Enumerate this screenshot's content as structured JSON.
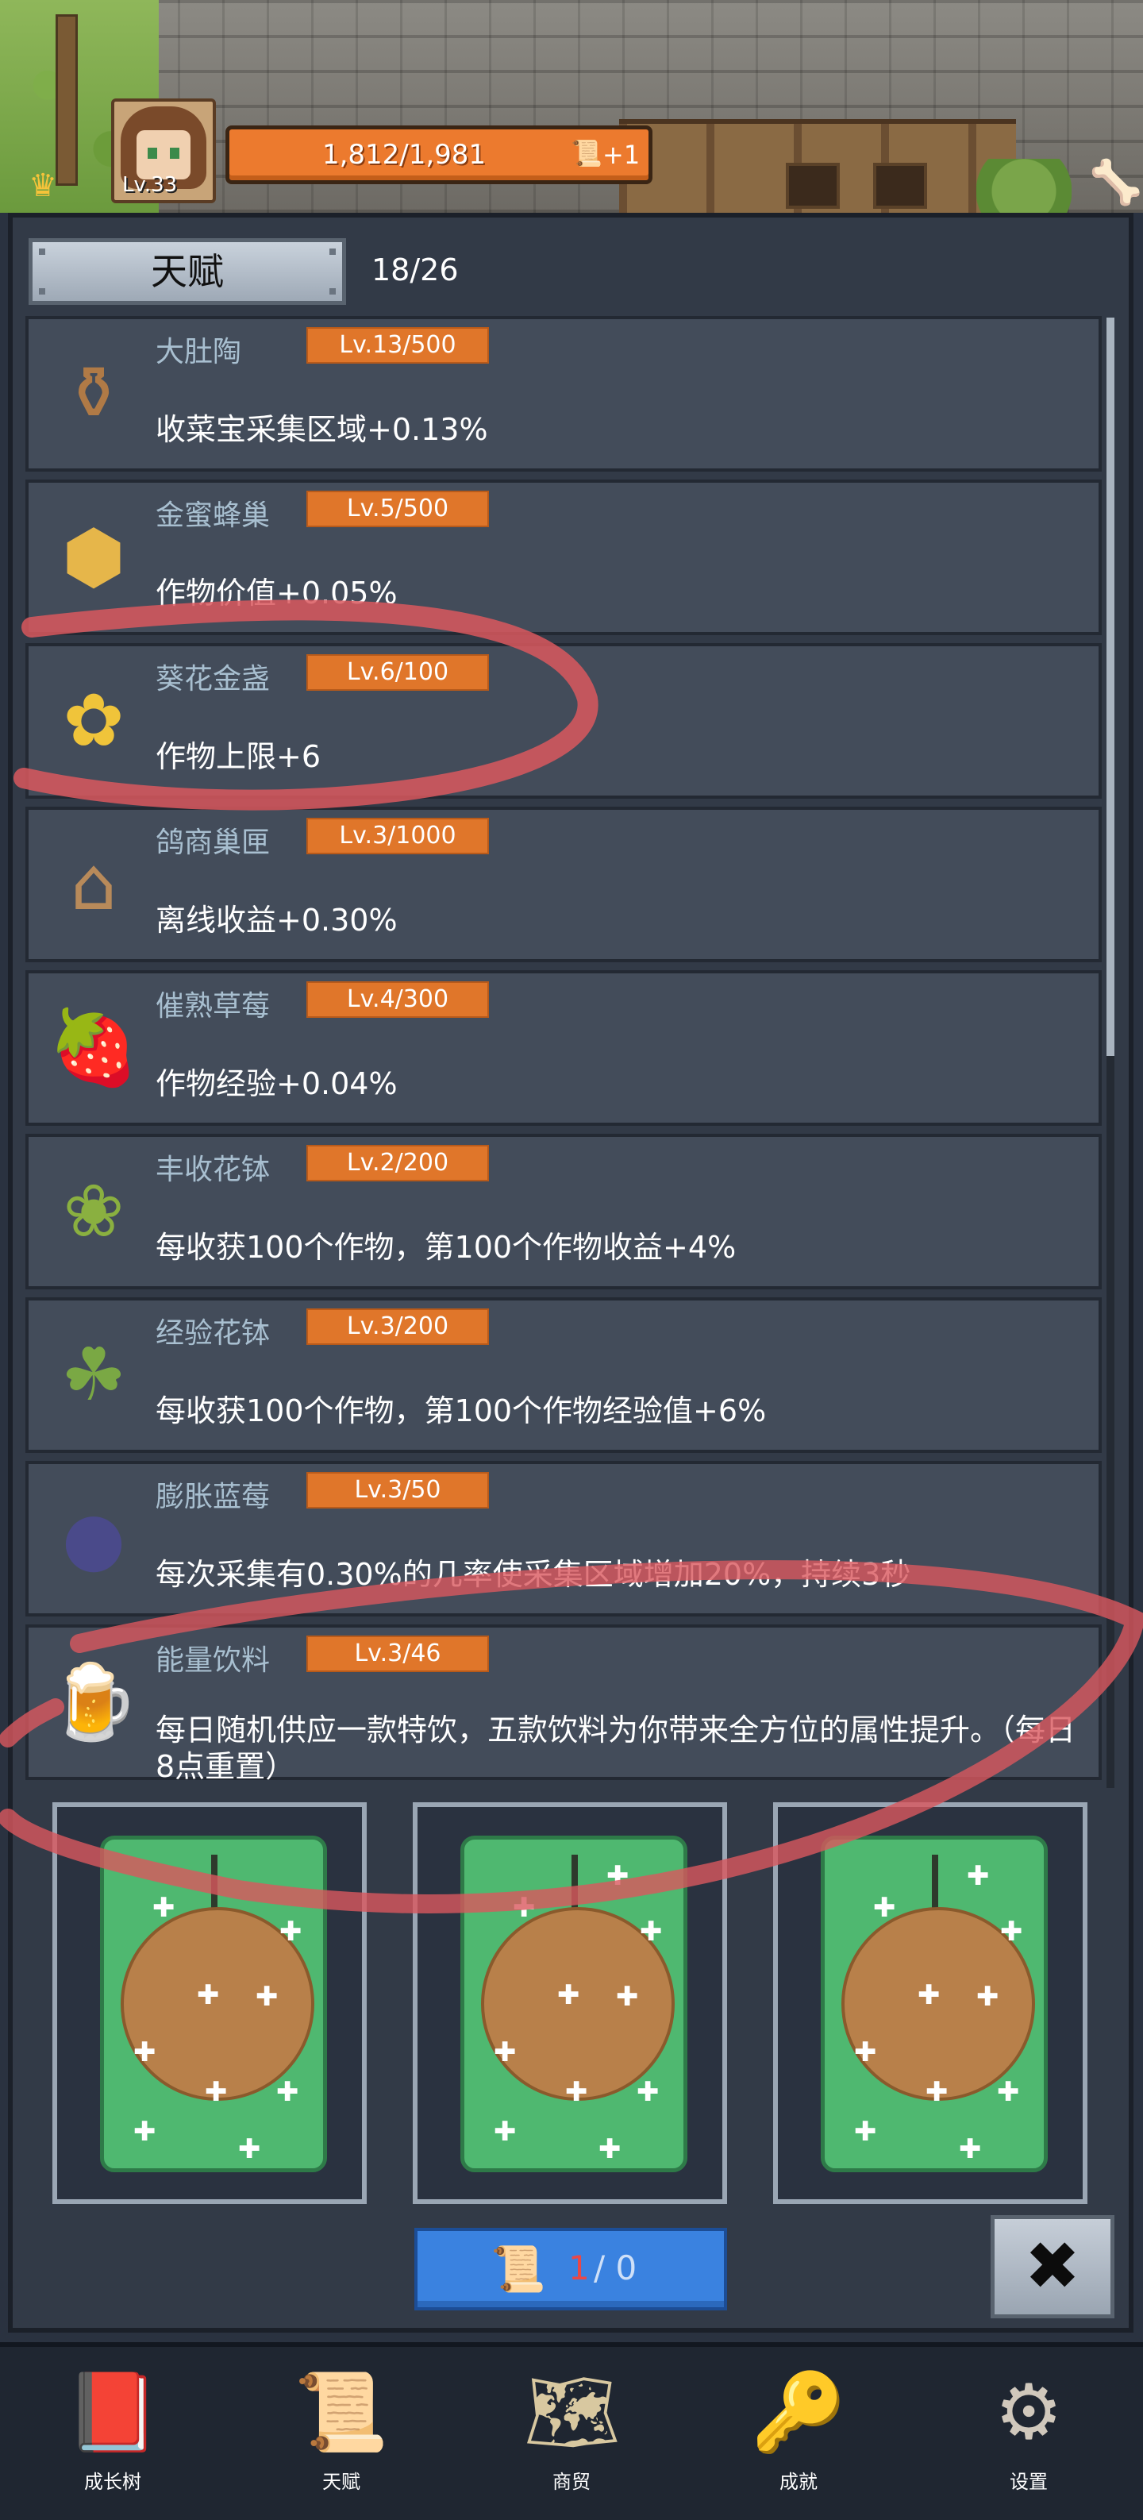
{
  "header": {
    "player_level": "Lv.33",
    "progress_text": "1,812/1,981",
    "bonus_text": "+1"
  },
  "panel": {
    "tab_label": "天赋",
    "count_text": "18/26"
  },
  "talents": [
    {
      "name": "大肚陶",
      "level": "Lv.13/500",
      "desc": "收菜宝采集区域+0.13%",
      "icon": "jar-icon"
    },
    {
      "name": "金蜜蜂巢",
      "level": "Lv.5/500",
      "desc": "作物价值+0.05%",
      "icon": "honeycomb-icon"
    },
    {
      "name": "葵花金盏",
      "level": "Lv.6/100",
      "desc": "作物上限+6",
      "icon": "sunflower-icon"
    },
    {
      "name": "鸽商巢匣",
      "level": "Lv.3/1000",
      "desc": "离线收益+0.30%",
      "icon": "birdhouse-icon"
    },
    {
      "name": "催熟草莓",
      "level": "Lv.4/300",
      "desc": "作物经验+0.04%",
      "icon": "strawberry-icon"
    },
    {
      "name": "丰收花钵",
      "level": "Lv.2/200",
      "desc": "每收获100个作物，第100个作物收益+4%",
      "icon": "flowerpot-icon"
    },
    {
      "name": "经验花钵",
      "level": "Lv.3/200",
      "desc": "每收获100个作物，第100个作物经验值+6%",
      "icon": "sprout-pot-icon"
    },
    {
      "name": "膨胀蓝莓",
      "level": "Lv.3/50",
      "desc": "每次采集有0.30%的几率使采集区域增加20%，持续3秒",
      "icon": "blueberry-icon"
    },
    {
      "name": "能量饮料",
      "level": "Lv.3/46",
      "desc": "每日随机供应一款特饮，五款饮料为你带来全方位的属性提升。（每日8点重置）",
      "icon": "drink-icon"
    }
  ],
  "scroll_counter": {
    "owned": "1",
    "separator_total": "/ 0"
  },
  "close_symbol": "✖",
  "nav": [
    {
      "label": "成长树",
      "icon": "book-icon"
    },
    {
      "label": "天赋",
      "icon": "scroll-icon"
    },
    {
      "label": "商贸",
      "icon": "map-icon"
    },
    {
      "label": "成就",
      "icon": "key-icon"
    },
    {
      "label": "设置",
      "icon": "gear-icon"
    }
  ],
  "colors": {
    "level_badge": "#e0762a",
    "talent_name": "#a8bfd0",
    "annotation_stroke": "#d9585e"
  }
}
